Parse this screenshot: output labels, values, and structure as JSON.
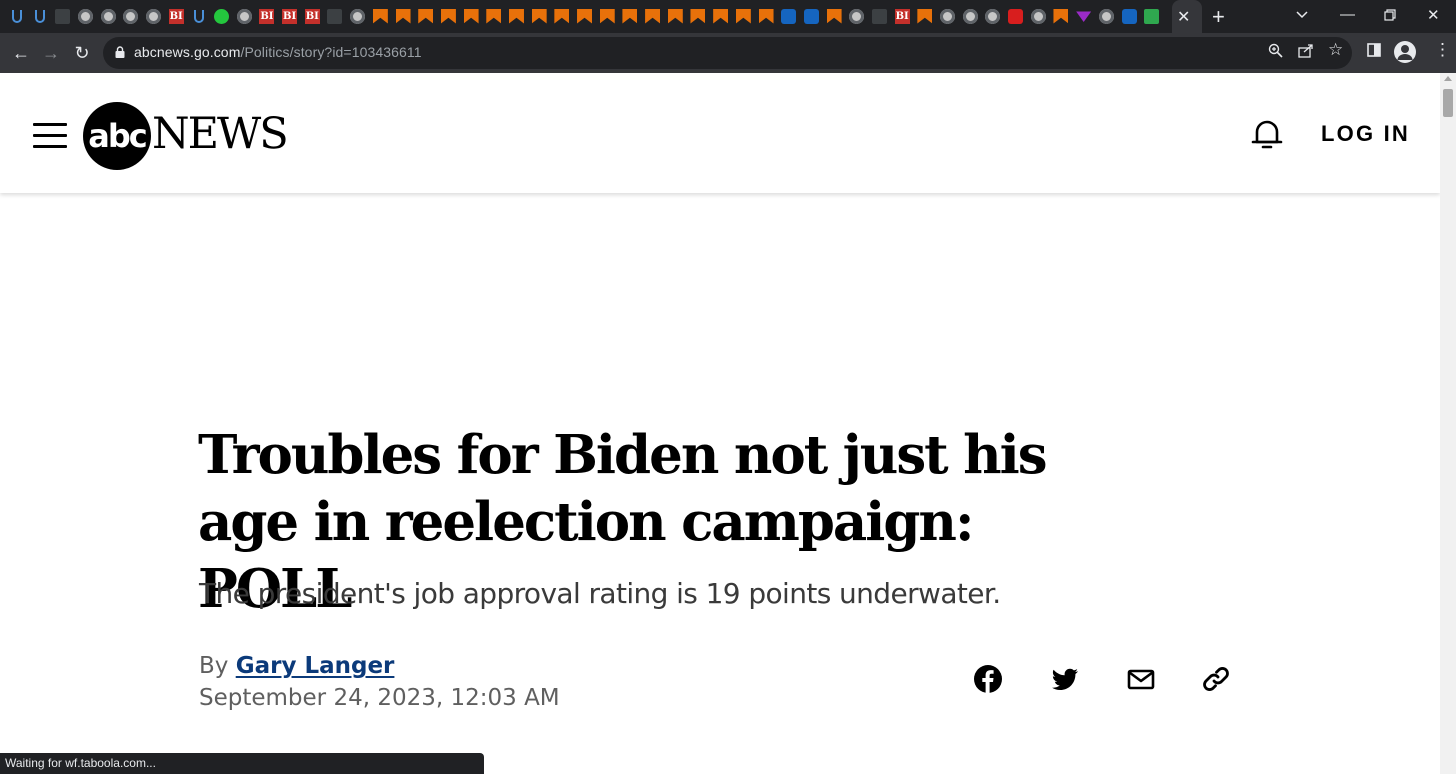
{
  "browser": {
    "url_host": "abcnews.go.com",
    "url_path": "/Politics/story?id=103436611",
    "status_text": "Waiting for wf.taboola.com...",
    "tab_favicons": [
      "shield",
      "shield",
      "dark",
      "globe",
      "globe",
      "globe",
      "globe",
      "bi",
      "shield",
      "play",
      "globe",
      "bi",
      "bi",
      "bi",
      "dark",
      "globe",
      "bookmark",
      "bookmark",
      "bookmark",
      "bookmark",
      "bookmark",
      "bookmark",
      "bookmark",
      "bookmark",
      "bookmark",
      "bookmark",
      "bookmark",
      "bookmark",
      "bookmark",
      "bookmark",
      "bookmark",
      "bookmark",
      "bookmark",
      "bookmark",
      "blue",
      "blue",
      "bookmark",
      "globe",
      "dark",
      "bi",
      "bookmark",
      "globe",
      "globe",
      "globe",
      "red",
      "globe",
      "bookmark",
      "violet",
      "globe",
      "blue",
      "green"
    ],
    "bi_glyph": "BI"
  },
  "header": {
    "logo_mark": "abc",
    "logo_word": "NEWS",
    "login_label": "LOG IN"
  },
  "article": {
    "headline": "Troubles for Biden not just his age in reelection campaign: POLL",
    "dek": "The president's job approval rating is 19 points underwater.",
    "by_prefix": "By",
    "author": "Gary Langer",
    "date": "September 24, 2023, 12:03 AM"
  },
  "colors": {
    "chrome_dark": "#202124",
    "chrome_toolbar": "#35363a",
    "author_link": "#0b3a7a",
    "dek_text": "#3a3a3a",
    "meta_text": "#5f5f5f"
  }
}
